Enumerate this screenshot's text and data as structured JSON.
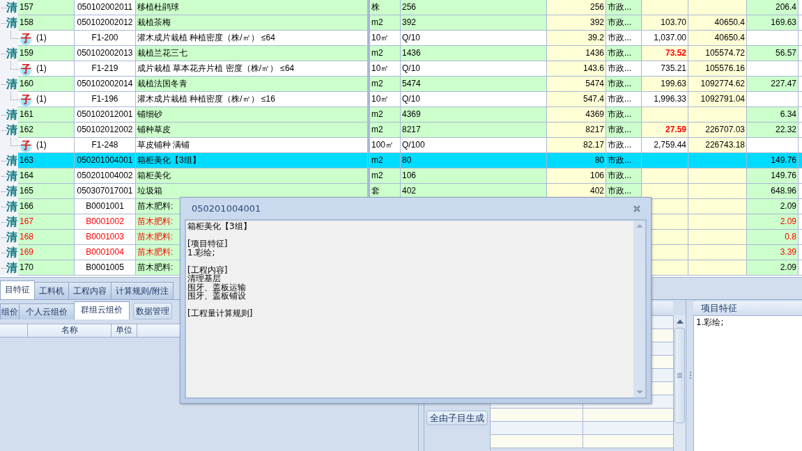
{
  "grid": {
    "rows": [
      {
        "kind": "item",
        "badge": "清",
        "number": "157",
        "code": "050102002011",
        "name": "移植杜鹃球",
        "unit": "株",
        "expression": "256",
        "quantity": "256",
        "category": "市政...",
        "rate": "206.4",
        "selected": false,
        "flagged": false
      },
      {
        "kind": "item",
        "badge": "清",
        "number": "158",
        "code": "050102002012",
        "name": "栽植茶梅",
        "unit": "m2",
        "expression": "392",
        "quantity": "392",
        "category": "市政...",
        "price": "103.70",
        "total": "40650.4",
        "rate": "169.63",
        "selected": false,
        "flagged": false,
        "price_alert": false
      },
      {
        "kind": "sub",
        "badge": "子",
        "number": "(1)",
        "code": "F1-200",
        "name": "灌木成片栽植 种植密度（株/㎡） ≤64",
        "unit": "10㎡",
        "expression": "Q/10",
        "quantity": "39.2",
        "category": "市政...",
        "price": "1,037.00",
        "total": "40650.4",
        "selected": false,
        "flagged": false,
        "price_alert": false
      },
      {
        "kind": "item",
        "badge": "清",
        "number": "159",
        "code": "050102002013",
        "name": "栽植兰花三七",
        "unit": "m2",
        "expression": "1436",
        "quantity": "1436",
        "category": "市政...",
        "price": "73.52",
        "total": "105574.72",
        "rate": "56.57",
        "selected": false,
        "flagged": false,
        "price_alert": true
      },
      {
        "kind": "sub",
        "badge": "子",
        "number": "(1)",
        "code": "F1-219",
        "name": "成片栽植 草本花卉片植 密度（株/㎡） ≤64",
        "unit": "10㎡",
        "expression": "Q/10",
        "quantity": "143.6",
        "category": "市政...",
        "price": "735.21",
        "total": "105576.16",
        "selected": false,
        "flagged": false,
        "price_alert": false
      },
      {
        "kind": "item",
        "badge": "清",
        "number": "160",
        "code": "050102002014",
        "name": "栽植法国冬青",
        "unit": "m2",
        "expression": "5474",
        "quantity": "5474",
        "category": "市政...",
        "price": "199.63",
        "total": "1092774.62",
        "rate": "227.47",
        "selected": false,
        "flagged": false,
        "price_alert": false
      },
      {
        "kind": "sub",
        "badge": "子",
        "number": "(1)",
        "code": "F1-196",
        "name": "灌木成片栽植 种植密度（株/㎡） ≤16",
        "unit": "10㎡",
        "expression": "Q/10",
        "quantity": "547.4",
        "category": "市政...",
        "price": "1,996.33",
        "total": "1092791.04",
        "selected": false,
        "flagged": false,
        "price_alert": false
      },
      {
        "kind": "item",
        "badge": "清",
        "number": "161",
        "code": "050102012001",
        "name": "铺细砂",
        "unit": "m2",
        "expression": "4369",
        "quantity": "4369",
        "category": "市政...",
        "rate": "6.34",
        "selected": false,
        "flagged": false
      },
      {
        "kind": "item",
        "badge": "清",
        "number": "162",
        "code": "050102012002",
        "name": "铺种草皮",
        "unit": "m2",
        "expression": "8217",
        "quantity": "8217",
        "category": "市政...",
        "price": "27.59",
        "total": "226707.03",
        "rate": "22.32",
        "selected": false,
        "flagged": false,
        "price_alert": true
      },
      {
        "kind": "sub",
        "badge": "子",
        "number": "(1)",
        "code": "F1-248",
        "name": "草皮铺种 满铺",
        "unit": "100㎡",
        "expression": "Q/100",
        "quantity": "82.17",
        "category": "市政...",
        "price": "2,759.44",
        "total": "226743.18",
        "selected": false,
        "flagged": false,
        "price_alert": false
      },
      {
        "kind": "item",
        "badge": "清",
        "number": "163",
        "code": "050201004001",
        "name": "箱柜美化【3组】",
        "unit": "m2",
        "expression": "80",
        "quantity": "80",
        "category": "市政...",
        "rate": "149.76",
        "selected": true,
        "flagged": false
      },
      {
        "kind": "item",
        "badge": "清",
        "number": "164",
        "code": "050201004002",
        "name": "箱柜美化",
        "unit": "m2",
        "expression": "106",
        "quantity": "106",
        "category": "市政...",
        "rate": "149.76",
        "selected": false,
        "flagged": false
      },
      {
        "kind": "item",
        "badge": "清",
        "number": "165",
        "code": "050307017001",
        "name": "垃圾箱",
        "unit": "套",
        "expression": "402",
        "quantity": "402",
        "category": "市政...",
        "rate": "648.96",
        "selected": false,
        "flagged": false
      },
      {
        "kind": "item",
        "badge": "清",
        "number": "166",
        "code": "B0001001",
        "name": "苗木肥料:",
        "rate": "2.09",
        "selected": false,
        "flagged": false
      },
      {
        "kind": "item",
        "badge": "清",
        "number": "167",
        "code": "B0001002",
        "name": "苗木肥料:",
        "rate": "2.09",
        "selected": false,
        "flagged": true
      },
      {
        "kind": "item",
        "badge": "清",
        "number": "168",
        "code": "B0001003",
        "name": "苗木肥料:",
        "rate": "0.8",
        "selected": false,
        "flagged": true
      },
      {
        "kind": "item",
        "badge": "清",
        "number": "169",
        "code": "B0001004",
        "name": "苗木肥料:",
        "rate": "3.39",
        "selected": false,
        "flagged": true
      },
      {
        "kind": "item",
        "badge": "清",
        "number": "170",
        "code": "B0001005",
        "name": "苗木肥料:",
        "rate": "2.09",
        "selected": false,
        "flagged": false
      }
    ]
  },
  "bottom": {
    "tabs": [
      {
        "label": "目特征",
        "selected": true
      },
      {
        "label": "工料机",
        "selected": false
      },
      {
        "label": "工程内容",
        "selected": false
      },
      {
        "label": "计算规则/附注",
        "selected": false
      }
    ],
    "subtabs": [
      {
        "label": "组价",
        "selected": false
      },
      {
        "label": "个人云组价",
        "selected": false
      },
      {
        "label": "群组云组价",
        "selected": true
      }
    ],
    "manage_button": "数据管理",
    "columns": [
      "名称",
      "单位"
    ],
    "generate_button": "全由子目生成",
    "feature_panel": {
      "title": "项目特征",
      "text": "1.彩绘;"
    }
  },
  "dialog": {
    "title": "050201004001",
    "blocks": [
      [
        "箱柜美化【3组】"
      ],
      [
        "[项目特征]",
        "1.彩绘;"
      ],
      [
        "[工程内容]",
        "清理基层",
        "围牙、盖板运输",
        "围牙、盖板铺设"
      ],
      [
        "[工程量计算规则]"
      ]
    ]
  }
}
